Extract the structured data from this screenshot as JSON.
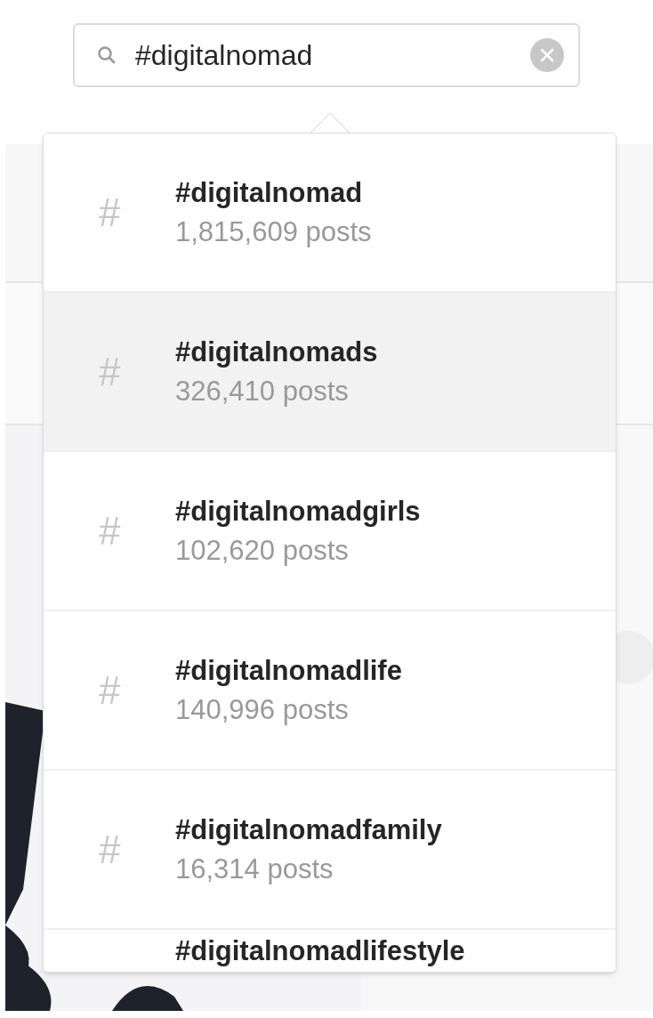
{
  "search": {
    "value": "#digitalnomad"
  },
  "results": [
    {
      "icon": "#",
      "tag": "#digitalnomad",
      "count": "1,815,609 posts",
      "selected": false
    },
    {
      "icon": "#",
      "tag": "#digitalnomads",
      "count": "326,410 posts",
      "selected": true
    },
    {
      "icon": "#",
      "tag": "#digitalnomadgirls",
      "count": "102,620 posts",
      "selected": false
    },
    {
      "icon": "#",
      "tag": "#digitalnomadlife",
      "count": "140,996 posts",
      "selected": false
    },
    {
      "icon": "#",
      "tag": "#digitalnomadfamily",
      "count": "16,314 posts",
      "selected": false
    },
    {
      "tag": "#digitalnomadlifestyle",
      "selected": false
    }
  ]
}
